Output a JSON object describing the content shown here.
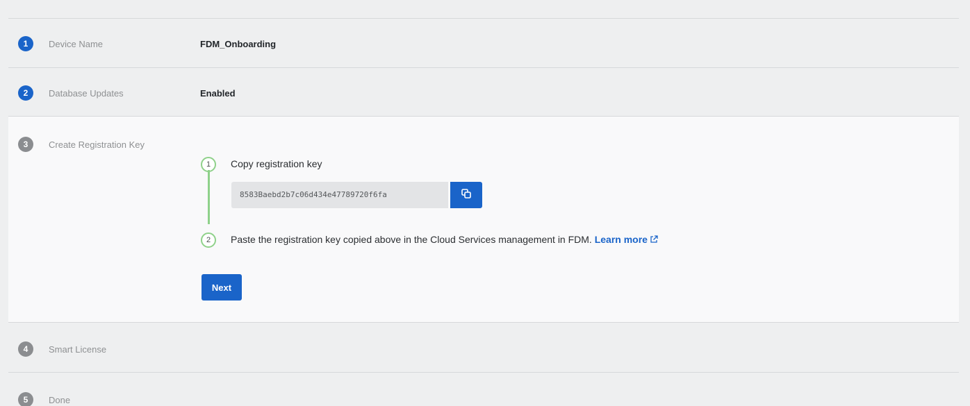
{
  "steps": [
    {
      "number": "1",
      "label": "Device Name",
      "value": "FDM_Onboarding",
      "state": "completed"
    },
    {
      "number": "2",
      "label": "Database Updates",
      "value": "Enabled",
      "state": "completed"
    },
    {
      "number": "3",
      "label": "Create Registration Key",
      "value": "",
      "state": "active"
    },
    {
      "number": "4",
      "label": "Smart License",
      "value": "",
      "state": "pending"
    },
    {
      "number": "5",
      "label": "Done",
      "value": "",
      "state": "pending"
    }
  ],
  "registration": {
    "substep1": {
      "number": "1",
      "text": "Copy registration key"
    },
    "key_value": "8583Baebd2b7c06d434e47789720f6fa",
    "copy_icon": "copy-icon",
    "substep2": {
      "number": "2",
      "text": "Paste the registration key copied above in the Cloud Services management in FDM. ",
      "link_text": "Learn more",
      "link_icon": "external-link-icon"
    },
    "next_label": "Next"
  },
  "colors": {
    "primary": "#1a64c9",
    "completed_step": "#1a64c9",
    "pending_step": "#8b8d90",
    "substep_ring": "#8fd18a",
    "background": "#eeeff0",
    "active_panel": "#f9f9fa"
  }
}
